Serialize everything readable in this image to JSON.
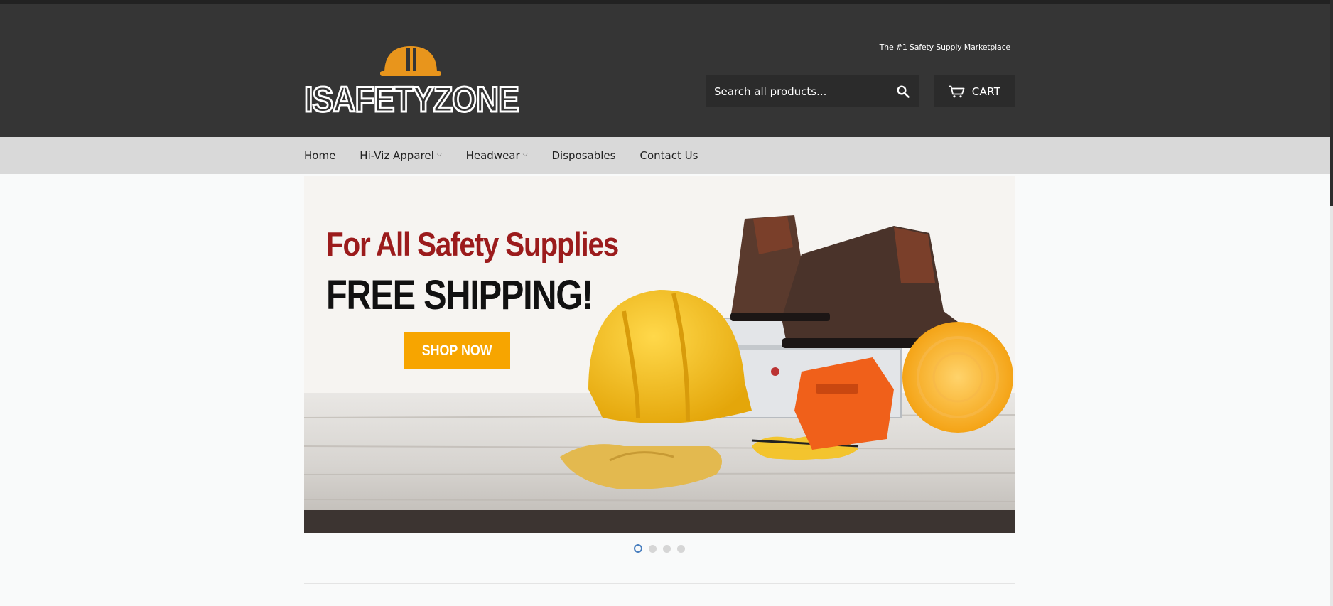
{
  "header": {
    "tagline": "The #1 Safety Supply Marketplace",
    "logo_text": "ISAFETYZONE",
    "search": {
      "placeholder": "Search all products..."
    },
    "cart_label": "CART"
  },
  "nav": {
    "items": [
      {
        "label": "Home"
      },
      {
        "label": "Hi-Viz Apparel",
        "dropdown": true
      },
      {
        "label": "Headwear",
        "dropdown": true
      },
      {
        "label": "Disposables"
      },
      {
        "label": "Contact Us"
      }
    ]
  },
  "hero": {
    "headline": "For All Safety Supplies",
    "subheadline": "FREE SHIPPING!",
    "cta_label": "SHOP NOW"
  },
  "slider": {
    "count": 4,
    "active": 1
  },
  "colors": {
    "header_bg": "#353535",
    "nav_bg": "#d9d9d9",
    "logo_helmet": "#e8951c",
    "headline_red": "#9b1b1c",
    "cta_orange": "#f7a500",
    "active_dot": "#4a7fbf"
  }
}
